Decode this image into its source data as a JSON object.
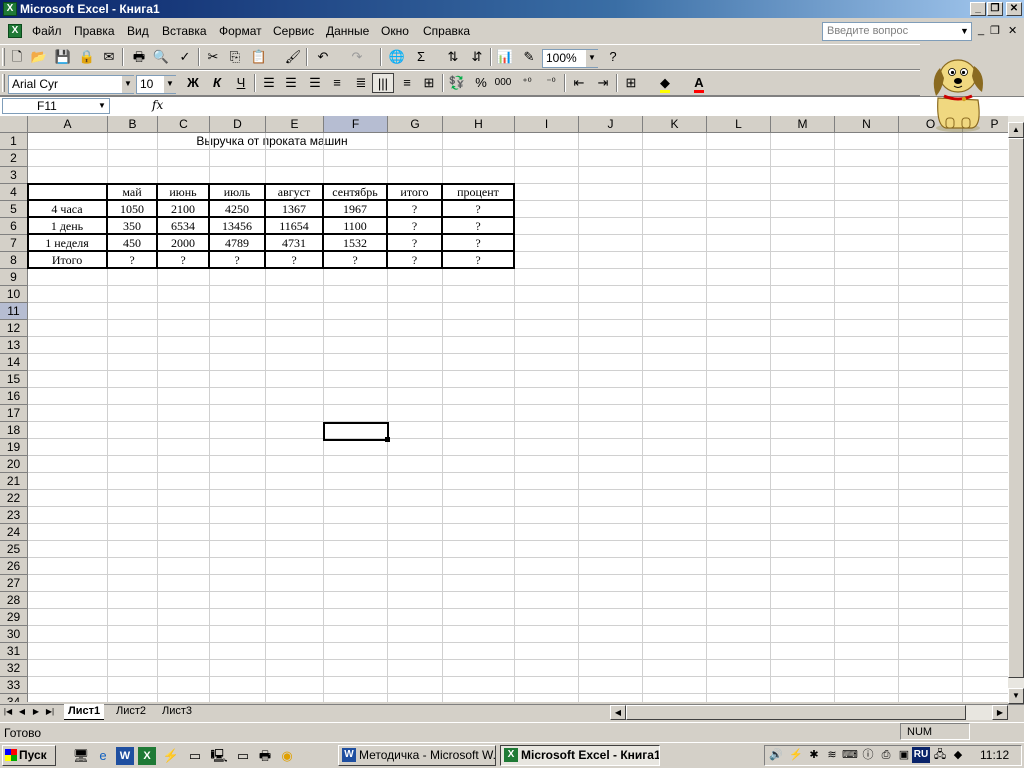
{
  "window": {
    "title": "Microsoft Excel - Книга1"
  },
  "menu": [
    "Файл",
    "Правка",
    "Вид",
    "Вставка",
    "Формат",
    "Сервис",
    "Данные",
    "Окно",
    "Справка"
  ],
  "question_box": {
    "placeholder": "Введите вопрос"
  },
  "toolbar": {
    "zoom": "100%",
    "font": "Arial Cyr",
    "font_size": "10",
    "bold": "Ж",
    "italic": "К",
    "underline": "Ч",
    "percent": "%",
    "thousands": "000"
  },
  "formula_bar": {
    "name_box": "F11",
    "fx": "fx",
    "content": ""
  },
  "columns": [
    "A",
    "B",
    "C",
    "D",
    "E",
    "F",
    "G",
    "H",
    "I",
    "J",
    "K",
    "L",
    "M",
    "N",
    "O",
    "P"
  ],
  "selected": {
    "column": "F",
    "row": 11
  },
  "sheet": {
    "title": "Выручка от проката машин",
    "headers": [
      "",
      "май",
      "июнь",
      "июль",
      "август",
      "сентябрь",
      "итого",
      "процент"
    ],
    "rows": [
      [
        "4 часа",
        "1050",
        "2100",
        "4250",
        "1367",
        "1967",
        "?",
        "?"
      ],
      [
        "1 день",
        "350",
        "6534",
        "13456",
        "11654",
        "1100",
        "?",
        "?"
      ],
      [
        "1 неделя",
        "450",
        "2000",
        "4789",
        "4731",
        "1532",
        "?",
        "?"
      ],
      [
        "Итого",
        "?",
        "?",
        "?",
        "?",
        "?",
        "?",
        "?"
      ]
    ]
  },
  "tabs": [
    "Лист1",
    "Лист2",
    "Лист3"
  ],
  "status": {
    "text": "Готово",
    "num": "NUM"
  },
  "taskbar": {
    "start": "Пуск",
    "tasks": [
      "Методичка - Microsoft W...",
      "Microsoft Excel - Книга1"
    ],
    "lang": "RU",
    "clock": "11:12"
  },
  "colors": {
    "title_active": "#0a246a",
    "excel_green": "#1f7a36",
    "selection_header": "#b6bdd2"
  }
}
